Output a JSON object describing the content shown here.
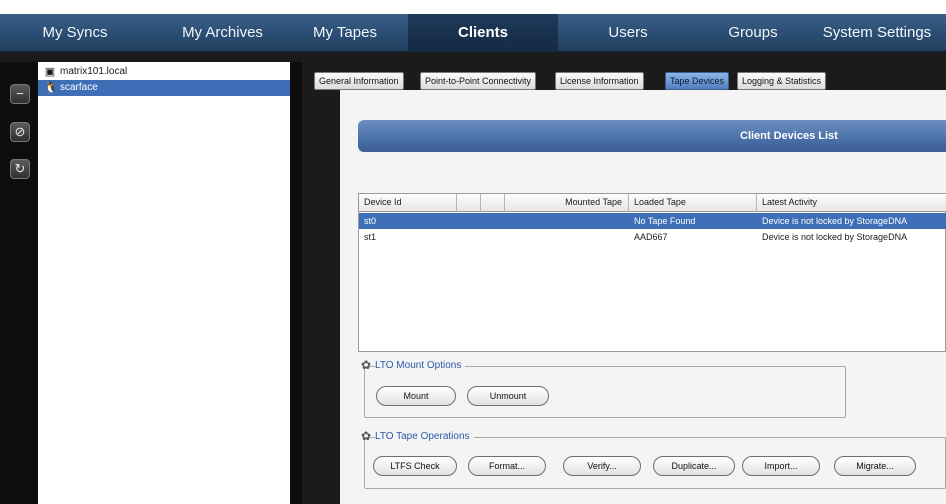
{
  "nav": {
    "items": [
      {
        "label": "My Syncs"
      },
      {
        "label": "My Archives"
      },
      {
        "label": "My Tapes"
      },
      {
        "label": "Clients"
      },
      {
        "label": "Users"
      },
      {
        "label": "Groups"
      },
      {
        "label": "System Settings"
      }
    ],
    "active": "Clients"
  },
  "sidebar": {
    "tree": [
      {
        "label": "matrix101.local",
        "icon": "mac-client-icon"
      },
      {
        "label": "scarface",
        "icon": "linux-client-icon",
        "selected": true
      }
    ],
    "buttons": [
      {
        "icon": "remove-icon",
        "glyph": "−"
      },
      {
        "icon": "disable-icon",
        "glyph": "⊘"
      },
      {
        "icon": "refresh-icon",
        "glyph": "↻"
      }
    ]
  },
  "tabs": [
    {
      "label": "General Information"
    },
    {
      "label": "Point-to-Point Connectivity"
    },
    {
      "label": "License Information"
    },
    {
      "label": "Tape Devices",
      "active": true
    },
    {
      "label": "Logging & Statistics"
    }
  ],
  "panel_title": "Client Devices List",
  "device_table": {
    "columns": [
      "Device Id",
      "",
      "",
      "Mounted Tape",
      "Loaded Tape",
      "Latest Activity"
    ],
    "rows": [
      {
        "device_id": "st0",
        "mounted_tape": "",
        "loaded_tape": "No Tape Found",
        "latest_activity": "Device is not locked by StorageDNA",
        "selected": true
      },
      {
        "device_id": "st1",
        "mounted_tape": "",
        "loaded_tape": "AAD667",
        "latest_activity": "Device is not locked by StorageDNA"
      }
    ]
  },
  "mount_options": {
    "legend": "LTO Mount Options",
    "buttons": [
      "Mount",
      "Unmount"
    ]
  },
  "tape_operations": {
    "legend": "LTO Tape Operations",
    "buttons": [
      "LTFS Check",
      "Format...",
      "Verify...",
      "Duplicate...",
      "Import...",
      "Migrate..."
    ]
  },
  "colors": {
    "nav_bg": "#2b4d73",
    "selection": "#3e6fb6",
    "accent_text": "#2a5aa8"
  }
}
